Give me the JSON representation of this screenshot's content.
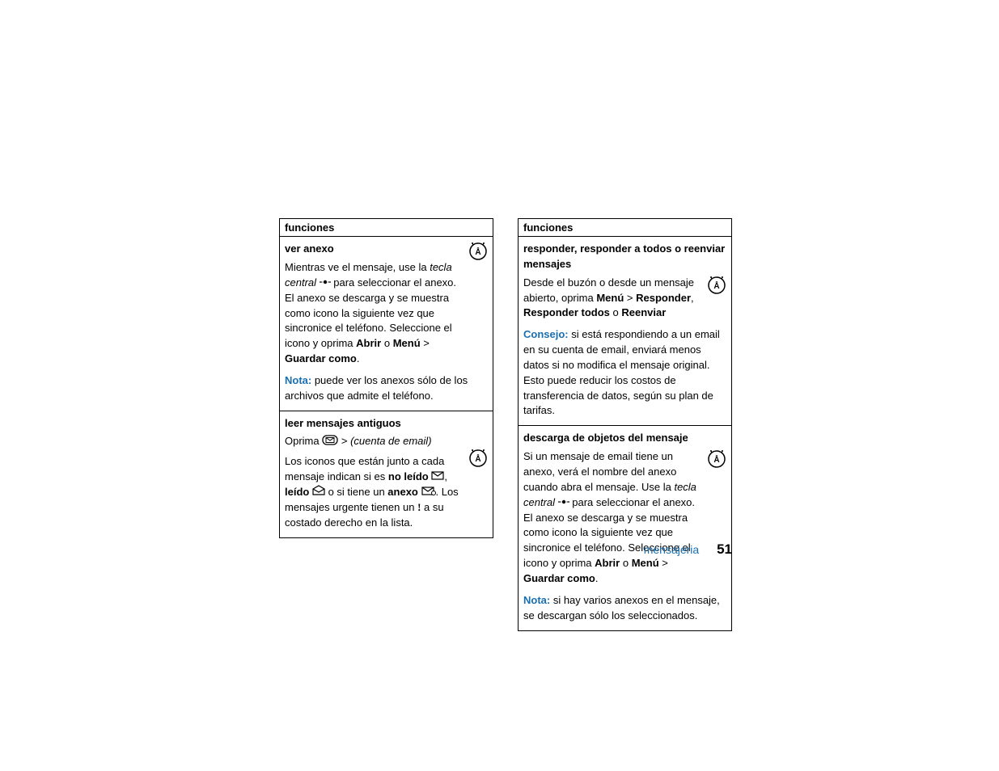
{
  "left": {
    "header": "funciones",
    "sec1": {
      "title": "ver anexo",
      "l1a": "Mientras ve el mensaje, use la",
      "l2a": "tecla central",
      "l2b": " para seleccionar el anexo. El anexo se descarga y se muestra como icono la siguiente vez que sincronice el teléfono. Seleccione el icono y oprima ",
      "abrir": "Abrir",
      "o1": " o ",
      "menu": "Menú",
      "gt": " > ",
      "guardar": "Guardar como",
      "dot": ".",
      "nota": "Nota:",
      "nota_txt": " puede ver los anexos sólo de los archivos que admite el teléfono."
    },
    "sec2": {
      "title": "leer mensajes antiguos",
      "l1a": "Oprima ",
      "l1b": " > ",
      "l1c": "(cuenta de email)",
      "l2": "Los iconos que están junto a cada mensaje indican si es ",
      "noleido": "no leído",
      "mid1": ", ",
      "leido": "leído",
      "mid2": " o si tiene un ",
      "anexo": "anexo",
      "mid3": ". Los mensajes urgente tienen un ",
      "urg": "!",
      "mid4": " a su costado derecho en la lista."
    }
  },
  "right": {
    "header": "funciones",
    "sec1": {
      "title": "responder, responder a todos o reenviar mensajes",
      "l1": "Desde el buzón o desde un mensaje abierto, oprima ",
      "menu": "Menú",
      "gt": " > ",
      "resp": "Responder",
      "sep1": ", ",
      "resptodos": "Responder todos",
      "o": " o ",
      "reenv": "Reenviar",
      "consejo": "Consejo:",
      "consejo_txt": " si está respondiendo a un email en su cuenta de email, enviará menos datos si no modifica el mensaje original. Esto puede reducir los costos de transferencia de datos, según su plan de tarifas."
    },
    "sec2": {
      "title": "descarga de objetos del mensaje",
      "l1": "Si un mensaje de email tiene un anexo, verá el nombre del anexo cuando abra el mensaje. Use la ",
      "tecla": "tecla central",
      "l1b": " para seleccionar el anexo. El anexo se descarga y se muestra como icono la siguiente vez que sincronice el teléfono. Seleccione el icono y oprima ",
      "abrir": "Abrir",
      "o1": " o ",
      "menu": "Menú",
      "gt": " > ",
      "guardar": "Guardar como",
      "dot": ".",
      "nota": "Nota:",
      "nota_txt": " si hay varios anexos en el mensaje, se descargan sólo los seleccionados."
    }
  },
  "footer": {
    "section": "mensajeria",
    "page": "51"
  }
}
